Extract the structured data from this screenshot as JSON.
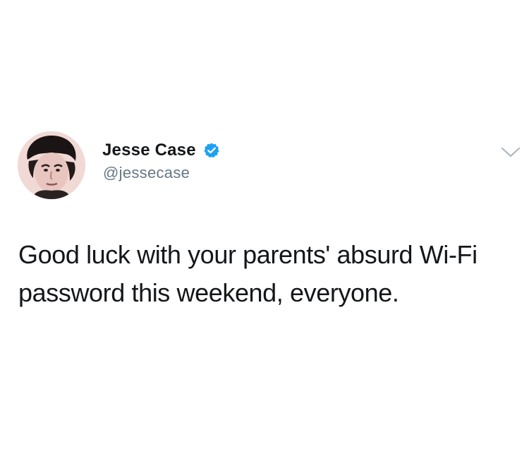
{
  "tweet": {
    "author": {
      "display_name": "Jesse Case",
      "handle": "@jessecase",
      "verified": true,
      "avatar_icon": "profile-photo"
    },
    "text": "Good luck with your parents' absurd Wi-Fi password this weekend, everyone.",
    "menu_icon": "chevron-down-icon"
  },
  "colors": {
    "background": "#ffffff",
    "text": "#14171a",
    "secondary_text": "#657786",
    "verified_blue": "#1da1f2",
    "caret": "#aab8c2"
  }
}
